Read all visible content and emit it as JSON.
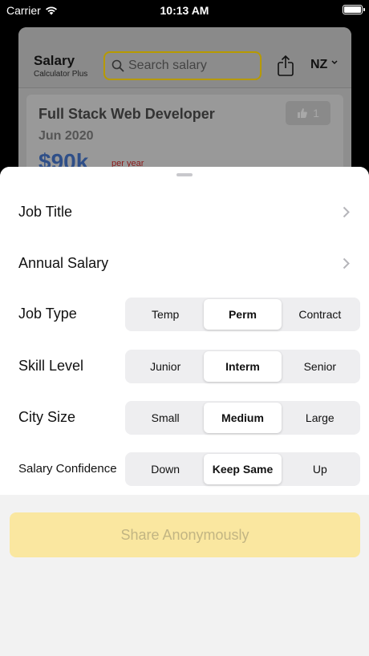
{
  "status_bar": {
    "carrier": "Carrier",
    "time": "10:13 AM"
  },
  "app": {
    "title": "Salary",
    "subtitle": "Calculator Plus",
    "region": "NZ",
    "search": {
      "placeholder": "Search salary"
    }
  },
  "job_card": {
    "title": "Full Stack Web Developer",
    "date": "Jun 2020",
    "salary": "$90k",
    "period": "per year",
    "likes": "1"
  },
  "form": {
    "job_title_label": "Job Title",
    "annual_salary_label": "Annual Salary",
    "job_type": {
      "label": "Job Type",
      "options": [
        "Temp",
        "Perm",
        "Contract"
      ],
      "selected": "Perm"
    },
    "skill_level": {
      "label": "Skill Level",
      "options": [
        "Junior",
        "Interm",
        "Senior"
      ],
      "selected": "Interm"
    },
    "city_size": {
      "label": "City Size",
      "options": [
        "Small",
        "Medium",
        "Large"
      ],
      "selected": "Medium"
    },
    "salary_confidence": {
      "label": "Salary Confidence",
      "options": [
        "Down",
        "Keep Same",
        "Up"
      ],
      "selected": "Keep Same"
    }
  },
  "share_button": {
    "label": "Share Anonymously"
  },
  "colors": {
    "accent_yellow": "#fae7a0",
    "search_border": "#b79a00",
    "salary_blue": "#2f4f88"
  }
}
